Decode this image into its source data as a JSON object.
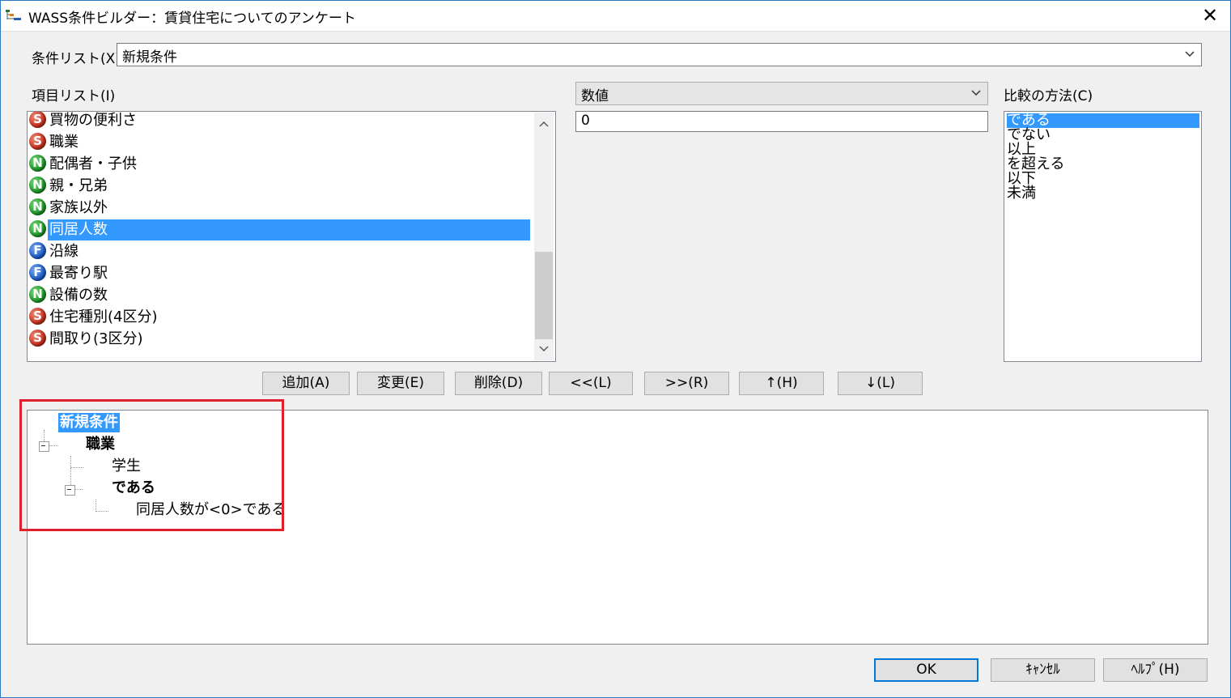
{
  "window": {
    "title": "WASS条件ビルダー：賃貸住宅についてのアンケート",
    "close_glyph": "✕"
  },
  "condition_list": {
    "label": "条件リスト(X)",
    "value": "新規条件"
  },
  "item_list": {
    "label": "項目リスト(I)",
    "items": [
      {
        "badge": "S",
        "label": "買物の便利さ"
      },
      {
        "badge": "S",
        "label": "職業"
      },
      {
        "badge": "N",
        "label": "配偶者・子供"
      },
      {
        "badge": "N",
        "label": "親・兄弟"
      },
      {
        "badge": "N",
        "label": "家族以外"
      },
      {
        "badge": "N",
        "label": "同居人数",
        "selected": true
      },
      {
        "badge": "F",
        "label": "沿線"
      },
      {
        "badge": "F",
        "label": "最寄り駅"
      },
      {
        "badge": "N",
        "label": "設備の数"
      },
      {
        "badge": "S",
        "label": "住宅種別(4区分)"
      },
      {
        "badge": "S",
        "label": "間取り(3区分)"
      }
    ]
  },
  "type_combo": {
    "value": "数値"
  },
  "value_input": {
    "value": "0"
  },
  "comparison": {
    "label": "比較の方法(C)",
    "options": [
      "である",
      "でない",
      "以上",
      "を超える",
      "以下",
      "未満"
    ],
    "selected_index": 0
  },
  "buttons": {
    "add": "追加(A)",
    "change": "変更(E)",
    "delete": "削除(D)",
    "left": "<<(L)",
    "right": ">>(R)",
    "up": "↑(H)",
    "down": "↓(L)"
  },
  "tree": {
    "root": "新規条件",
    "node1": "職業",
    "node1_child": "学生",
    "node2": "である",
    "node2_child": "同居人数が<0>である"
  },
  "footer": {
    "ok": "OK",
    "cancel": "ｷｬﾝｾﾙ",
    "help": "ﾍﾙﾌﾟ(H)"
  },
  "colors": {
    "selection": "#3399ff",
    "highlight_box": "#e0202a",
    "badge_s": "#c8321f",
    "badge_n": "#1f9a2a",
    "badge_f": "#1f5fc8"
  }
}
